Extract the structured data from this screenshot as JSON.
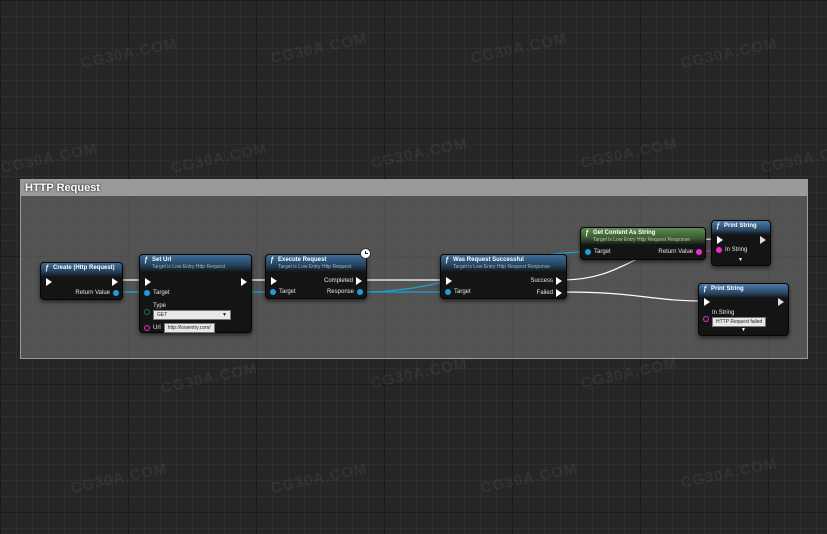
{
  "comment": {
    "title": "HTTP Request"
  },
  "watermark": "CG30A.COM",
  "nodes": {
    "create": {
      "title": "Create (Http Request)",
      "return_label": "Return Value"
    },
    "seturl": {
      "title": "Set Url",
      "subtitle": "Target is Low Entry Http Request",
      "target_label": "Target",
      "type_label": "Type",
      "type_value": "GET",
      "url_label": "Url",
      "url_value": "http://lowentry.com/"
    },
    "execute": {
      "title": "Execute Request",
      "subtitle": "Target is Low Entry Http Request",
      "completed_label": "Completed",
      "target_label": "Target",
      "response_label": "Response"
    },
    "was": {
      "title": "Was Request Successful",
      "subtitle": "Target is Low Entry Http Request Response",
      "success_label": "Success",
      "target_label": "Target",
      "failed_label": "Failed"
    },
    "getcontent": {
      "title": "Get Content As String",
      "subtitle": "Target is Low Entry Http Request Response",
      "target_label": "Target",
      "return_label": "Return Value"
    },
    "print1": {
      "title": "Print String",
      "instring_label": "In String"
    },
    "print2": {
      "title": "Print String",
      "instring_label": "In String",
      "instring_value": "HTTP Request failed"
    }
  },
  "colors": {
    "exec": "#ffffff",
    "object_pin": "#1e9ed6",
    "string_pin": "#f02bcc",
    "header": "#3f6e9b",
    "pure_header": "#5d8a4e"
  },
  "icons": {
    "function": "function-icon",
    "latent": "clock-icon",
    "expand": "chevron-down-icon"
  }
}
